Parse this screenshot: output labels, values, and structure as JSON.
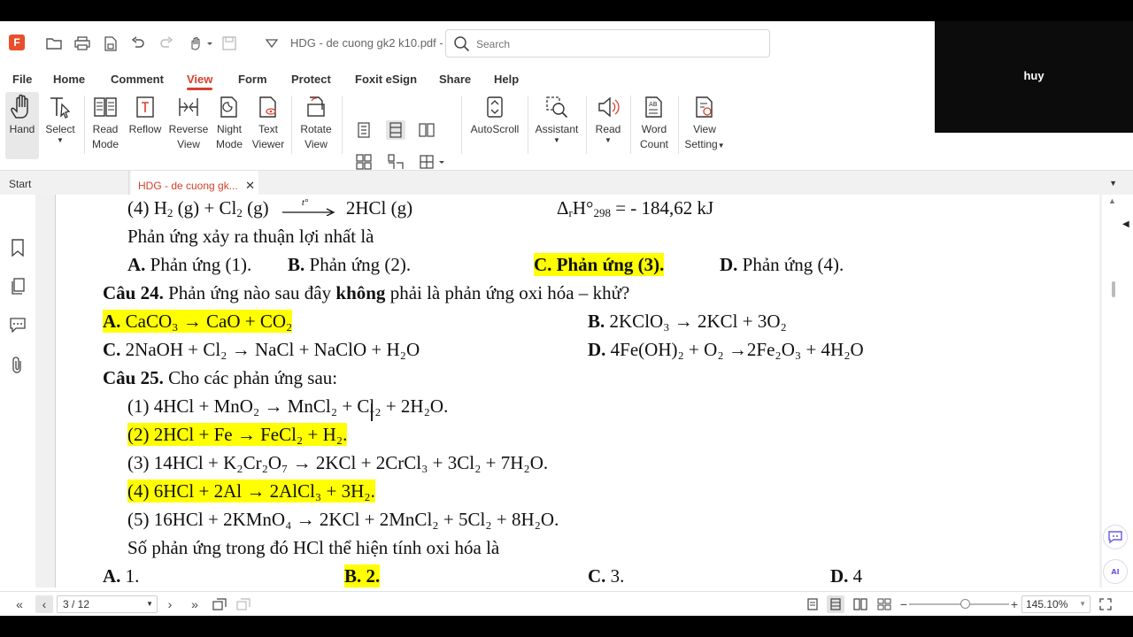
{
  "video_overlay": {
    "participant_name": "huy"
  },
  "titlebar": {
    "doc_title": "HDG - de cuong gk2 k10.pdf - ...",
    "search_placeholder": "Search"
  },
  "menu": [
    "File",
    "Home",
    "Comment",
    "View",
    "Form",
    "Protect",
    "Foxit eSign",
    "Share",
    "Help"
  ],
  "active_menu": "View",
  "ribbon": {
    "hand": "Hand",
    "select": "Select",
    "read_mode": [
      "Read",
      "Mode"
    ],
    "reflow": "Reflow",
    "reverse_view": [
      "Reverse",
      "View"
    ],
    "night_mode": [
      "Night",
      "Mode"
    ],
    "text_viewer": [
      "Text",
      "Viewer"
    ],
    "rotate_view": [
      "Rotate",
      "View"
    ],
    "autoscroll": "AutoScroll",
    "assistant": "Assistant",
    "read": "Read",
    "word_count": [
      "Word",
      "Count"
    ],
    "view_setting": [
      "View",
      "Setting"
    ]
  },
  "tabs": {
    "start": "Start",
    "doc": "HDG - de cuong gk..."
  },
  "document": {
    "l1_a": "(4) H",
    "l1_b": " (g) + Cl",
    "l1_c": " (g)",
    "l1_arrow_label": "t°",
    "l1_d": "2HCl (g)",
    "l1_dh": "Δ",
    "l1_dh_r": "r",
    "l1_dh_rest": "H°",
    "l1_dh_298": "298",
    "l1_dh_value": " = - 184,62 kJ",
    "l2": "Phản ứng xảy ra thuận lợi nhất là",
    "q23_a_letter": "A.",
    "q23_a": " Phản ứng (1).",
    "q23_b_letter": "B.",
    "q23_b": " Phản ứng (2).",
    "q23_c": "C. Phản ứng (3).",
    "q23_d_letter": "D.",
    "q23_d": " Phản ứng (4).",
    "q24_label": "Câu 24.",
    "q24_text_1": " Phản ứng nào sau đây ",
    "q24_bold": "không",
    "q24_text_2": " phải là phản ứng oxi hóa – khử?",
    "q24_a_letter": "A.",
    "q24_a": " CaCO₃ → CaO + CO₂",
    "q24_b_letter": "B.",
    "q24_b": " 2KClO₃ → 2KCl + 3O₂",
    "q24_c_letter": "C.",
    "q24_c": " 2NaOH + Cl₂  → NaCl + NaClO + H₂O",
    "q24_d_letter": "D.",
    "q24_d": " 4Fe(OH)₂ + O₂ →2Fe₂O₃ + 4H₂O",
    "q25_label": "Câu 25.",
    "q25_text": " Cho các phản ứng sau:",
    "r1": "(1) 4HCl + MnO₂  →     MnCl₂  + Cl₂  + 2H₂O.",
    "r2": "(2) 2HCl + Fe →  FeCl₂  + H₂.",
    "r3": "(3) 14HCl + K₂Cr₂O₇   →    2KCl + 2CrCl₃  + 3Cl₂   + 7H₂O.",
    "r4": "(4) 6HCl + 2Al →  2AlCl₃  + 3H₂.",
    "r5": "(5) 16HCl + 2KMnO₄  →  2KCl + 2MnCl₂  + 5Cl₂  + 8H₂O.",
    "q25_prompt": "Số phản ứng trong đó HCl thể hiện tính oxi hóa là",
    "ans_a_letter": "A.",
    "ans_a": " 1.",
    "ans_b": "B. 2.",
    "ans_c_letter": "C.",
    "ans_c": " 3.",
    "ans_d_letter": "D.",
    "ans_d": " 4"
  },
  "statusbar": {
    "page_indicator": "3 / 12",
    "zoom": "145.10%",
    "zoom_level_fraction": 0.5
  },
  "colors": {
    "accent": "#d4402b",
    "highlight": "#ffff00"
  }
}
